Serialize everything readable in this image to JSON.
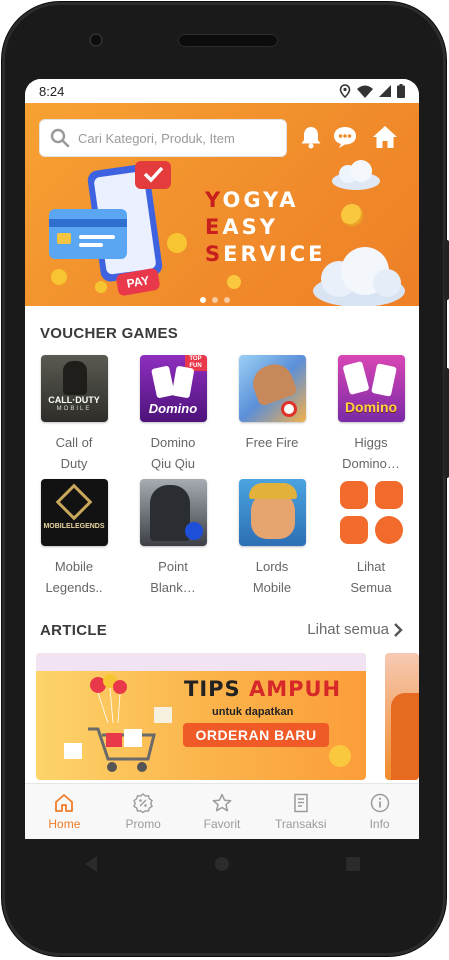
{
  "status_bar": {
    "time": "8:24"
  },
  "search": {
    "placeholder": "Cari Kategori, Produk, Item"
  },
  "banner": {
    "lines": [
      {
        "first": "Y",
        "rest": "OGYA"
      },
      {
        "first": "E",
        "rest": "ASY"
      },
      {
        "first": "S",
        "rest": "ERVICE"
      }
    ],
    "pay_label": "PAY",
    "slides": 3,
    "active_slide": 0
  },
  "voucher_games": {
    "title": "VOUCHER GAMES",
    "items": [
      {
        "line1": "Call of",
        "line2": "Duty",
        "icon": "call-of-duty-icon"
      },
      {
        "line1": "Domino",
        "line2": "Qiu Qiu",
        "icon": "domino-qiu-qiu-icon"
      },
      {
        "line1": "Free Fire",
        "line2": "",
        "icon": "free-fire-icon"
      },
      {
        "line1": "Higgs",
        "line2": "Domino…",
        "icon": "higgs-domino-icon"
      },
      {
        "line1": "Mobile",
        "line2": "Legends..",
        "icon": "mobile-legends-icon"
      },
      {
        "line1": "Point",
        "line2": "Blank…",
        "icon": "point-blank-icon"
      },
      {
        "line1": "Lords",
        "line2": "Mobile",
        "icon": "lords-mobile-icon"
      },
      {
        "line1": "Lihat",
        "line2": "Semua",
        "icon": "grid-icon"
      }
    ],
    "tile_text": {
      "cod": "CALL·DUTY",
      "cod_sub": "MOBILE",
      "domino": "Domino",
      "topfun": "TOP FUN",
      "higgs": "Domino",
      "ml": "MOBILELEGENDS"
    }
  },
  "article": {
    "title": "ARTICLE",
    "see_all": "Lihat semua",
    "cards": [
      {
        "headline_1": "TIPS",
        "headline_2": "AMPUH",
        "sub": "untuk dapatkan",
        "cta": "ORDERAN BARU"
      }
    ]
  },
  "bottom_nav": [
    {
      "label": "Home",
      "icon": "home-icon",
      "active": true
    },
    {
      "label": "Promo",
      "icon": "promo-badge-icon",
      "active": false
    },
    {
      "label": "Favorit",
      "icon": "star-icon",
      "active": false
    },
    {
      "label": "Transaksi",
      "icon": "receipt-icon",
      "active": false
    },
    {
      "label": "Info",
      "icon": "info-icon",
      "active": false
    }
  ],
  "colors": {
    "brand_orange": "#ef7d27",
    "banner_red": "#c81e1e",
    "grid_orange": "#f26a2c"
  }
}
